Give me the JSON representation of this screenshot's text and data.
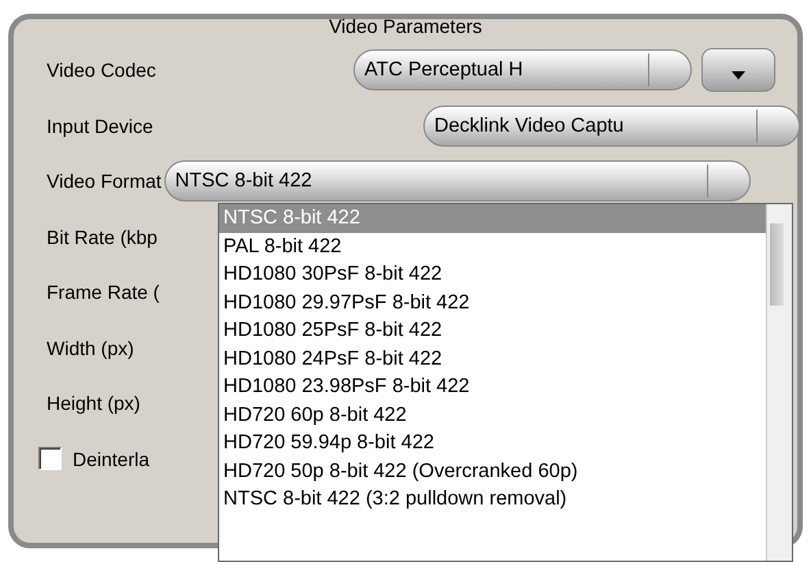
{
  "group": {
    "title": "Video Parameters"
  },
  "fields": [
    {
      "kind": "combo_button",
      "label": "Video Codec",
      "value": "ATC Perceptual H"
    },
    {
      "kind": "combo",
      "label": "Input Device",
      "value": "Decklink Video Captu"
    },
    {
      "kind": "combo_wide",
      "label": "Video Format",
      "value": "NTSC 8-bit 422"
    },
    {
      "kind": "label",
      "label": "Bit Rate (kbp"
    },
    {
      "kind": "label",
      "label": "Frame Rate ("
    },
    {
      "kind": "label",
      "label": "Width (px)"
    },
    {
      "kind": "label",
      "label": "Height (px)"
    },
    {
      "kind": "checkbox",
      "label": "Deinterla",
      "checked": false
    }
  ],
  "dropdown": {
    "items": [
      {
        "label": "NTSC 8-bit 422",
        "selected": true
      },
      {
        "label": "PAL 8-bit 422",
        "selected": false
      },
      {
        "label": "HD1080 30PsF 8-bit 422",
        "selected": false
      },
      {
        "label": "HD1080 29.97PsF 8-bit 422",
        "selected": false
      },
      {
        "label": "HD1080 25PsF 8-bit 422",
        "selected": false
      },
      {
        "label": "HD1080 24PsF 8-bit 422",
        "selected": false
      },
      {
        "label": "HD1080 23.98PsF 8-bit 422",
        "selected": false
      },
      {
        "label": "HD720 60p 8-bit 422",
        "selected": false
      },
      {
        "label": "HD720 59.94p 8-bit 422",
        "selected": false
      },
      {
        "label": "HD720 50p 8-bit 422 (Overcranked 60p)",
        "selected": false
      },
      {
        "label": "NTSC 8-bit 422 (3:2 pulldown removal)",
        "selected": false
      }
    ]
  }
}
